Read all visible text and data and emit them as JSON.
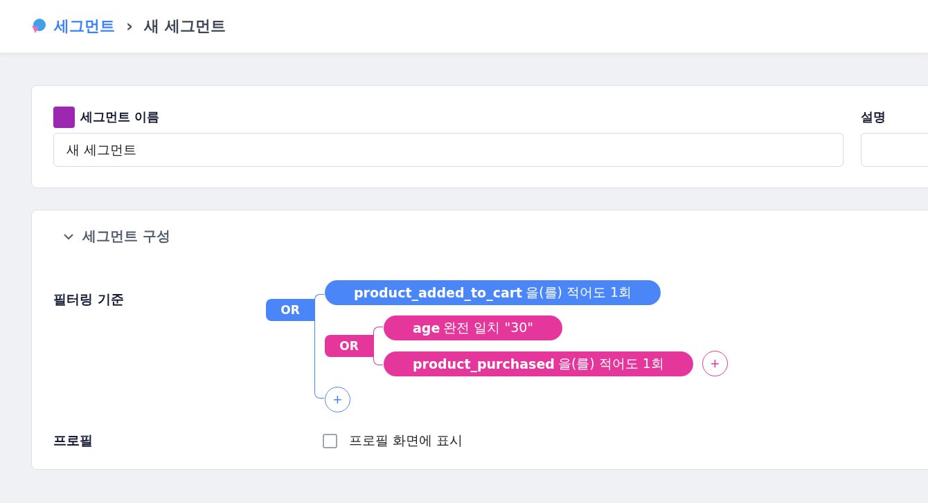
{
  "breadcrumb": {
    "parent": "세그먼트",
    "separator": "›",
    "current": "새 세그먼트"
  },
  "name_form": {
    "name_label": "세그먼트 이름",
    "name_value": "새 세그먼트",
    "description_label": "설명"
  },
  "composition": {
    "title": "세그먼트 구성",
    "expanded": true,
    "filter_label": "필터링 기준",
    "filter": {
      "kind": "group",
      "operator": "OR",
      "color": "#4a86f7",
      "add_label": "+",
      "children": [
        {
          "kind": "condition",
          "field": "product_added_to_cart",
          "rest": "을(를) 적어도 1회"
        },
        {
          "kind": "group",
          "operator": "OR",
          "color": "#e5379b",
          "add_label": "+",
          "children": [
            {
              "kind": "condition",
              "field": "age",
              "rest": "완전 일치 \"30\""
            },
            {
              "kind": "condition",
              "field": "product_purchased",
              "rest": "을(를) 적어도 1회"
            }
          ]
        }
      ]
    },
    "profile_label": "프로필",
    "profile_option": {
      "label": "프로필 화면에 표시",
      "checked": false
    }
  }
}
